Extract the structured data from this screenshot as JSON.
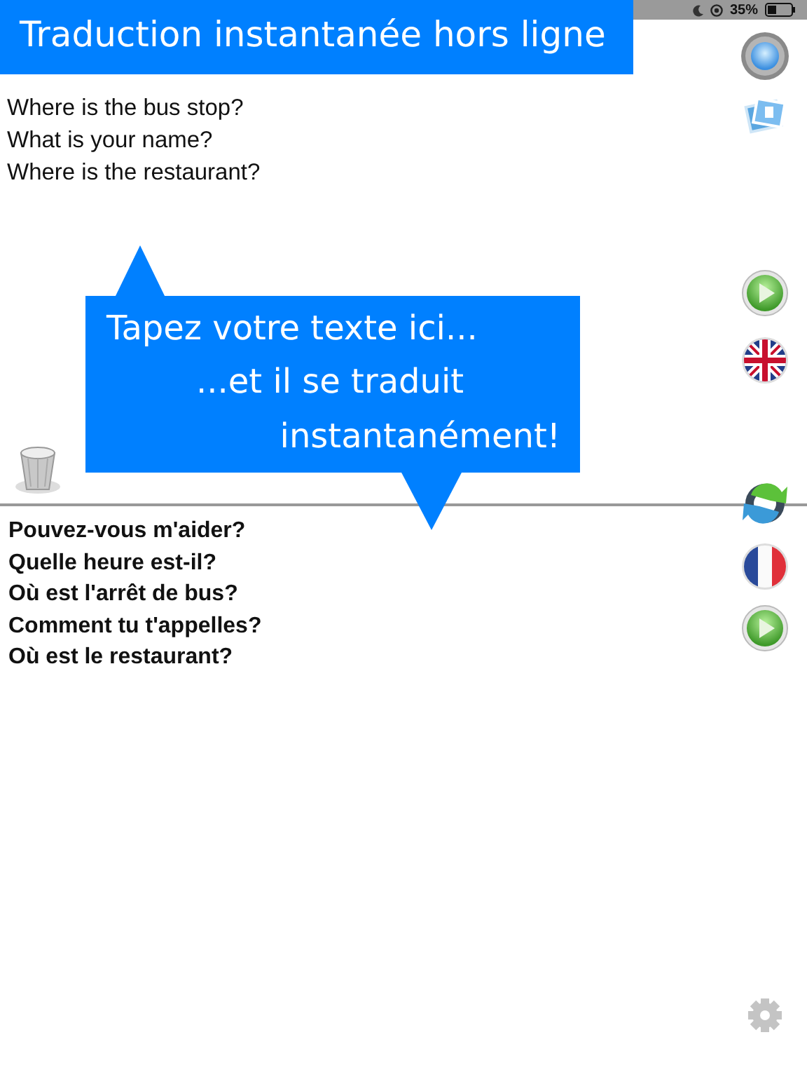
{
  "status_bar": {
    "battery": "35%"
  },
  "banner": {
    "title": "Traduction instantanée hors ligne"
  },
  "source_lines": [
    "Where is the bus stop?",
    "What is your name?",
    "Where is the restaurant?"
  ],
  "callout": {
    "lines": [
      "Tapez votre texte ici...",
      "...et il se traduit",
      "instantanément!"
    ]
  },
  "translation_lines": [
    "Pouvez-vous m'aider?",
    "Quelle heure est-il?",
    "Où est l'arrêt de bus?",
    "Comment tu t'appelles?",
    "Où est le restaurant?"
  ]
}
